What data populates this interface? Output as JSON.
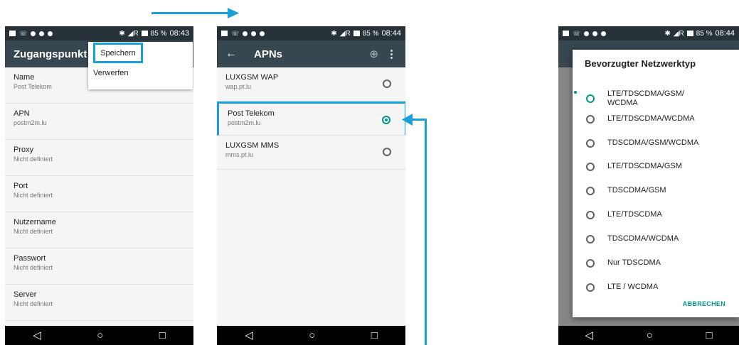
{
  "status": {
    "phone1_time": "08:43",
    "time": "08:44",
    "battery": "85 %"
  },
  "phone1": {
    "title": "Zugangspunkt b",
    "menu": {
      "save": "Speichern",
      "discard": "Verwerfen"
    },
    "fields": [
      {
        "label": "Name",
        "value": "Post Telekom"
      },
      {
        "label": "APN",
        "value": "postm2m.lu"
      },
      {
        "label": "Proxy",
        "value": "Nicht definiert"
      },
      {
        "label": "Port",
        "value": "Nicht definiert"
      },
      {
        "label": "Nutzername",
        "value": "Nicht definiert"
      },
      {
        "label": "Passwort",
        "value": "Nicht definiert"
      },
      {
        "label": "Server",
        "value": "Nicht definiert"
      }
    ]
  },
  "phone2": {
    "title": "APNs",
    "apns": [
      {
        "name": "LUXGSM WAP",
        "apn": "wap.pt.lu",
        "selected": false
      },
      {
        "name": "Post Telekom",
        "apn": "postm2m.lu",
        "selected": true
      },
      {
        "name": "LUXGSM MMS",
        "apn": "mms.pt.lu",
        "selected": false
      }
    ]
  },
  "phone3": {
    "dialog_title": "Bevorzugter Netzwerktyp",
    "options": [
      {
        "label": "LTE/TDSCDMA/GSM/\nWCDMA",
        "selected": true
      },
      {
        "label": "LTE/TDSCDMA/WCDMA",
        "selected": false
      },
      {
        "label": "TDSCDMA/GSM/WCDMA",
        "selected": false
      },
      {
        "label": "LTE/TDSCDMA/GSM",
        "selected": false
      },
      {
        "label": "TDSCDMA/GSM",
        "selected": false
      },
      {
        "label": "LTE/TDSCDMA",
        "selected": false
      },
      {
        "label": "TDSCDMA/WCDMA",
        "selected": false
      },
      {
        "label": "Nur TDSCDMA",
        "selected": false
      },
      {
        "label": "LTE / WCDMA",
        "selected": false
      }
    ],
    "cancel": "ABBRECHEN"
  },
  "nav": {
    "back": "◁",
    "home": "○",
    "recent": "□"
  },
  "colors": {
    "accent": "#009688",
    "highlight": "#1aa0d8",
    "appbar": "#37474f",
    "statusbar": "#263238"
  }
}
